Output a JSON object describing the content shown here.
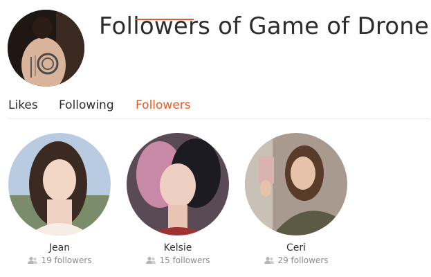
{
  "page": {
    "title": "Followers of Game of Drone II"
  },
  "tabs": [
    {
      "label": "Likes",
      "active": false
    },
    {
      "label": "Following",
      "active": false
    },
    {
      "label": "Followers",
      "active": true
    }
  ],
  "colors": {
    "accent": "#e25c23",
    "text": "#2d2d2d",
    "muted": "#8a8a8a"
  },
  "followers": [
    {
      "name": "Jean",
      "followers": "19 followers",
      "icon": "people-icon"
    },
    {
      "name": "Kelsie",
      "followers": "15 followers",
      "icon": "people-icon"
    },
    {
      "name": "Ceri",
      "followers": "29 followers",
      "icon": "people-icon"
    }
  ]
}
